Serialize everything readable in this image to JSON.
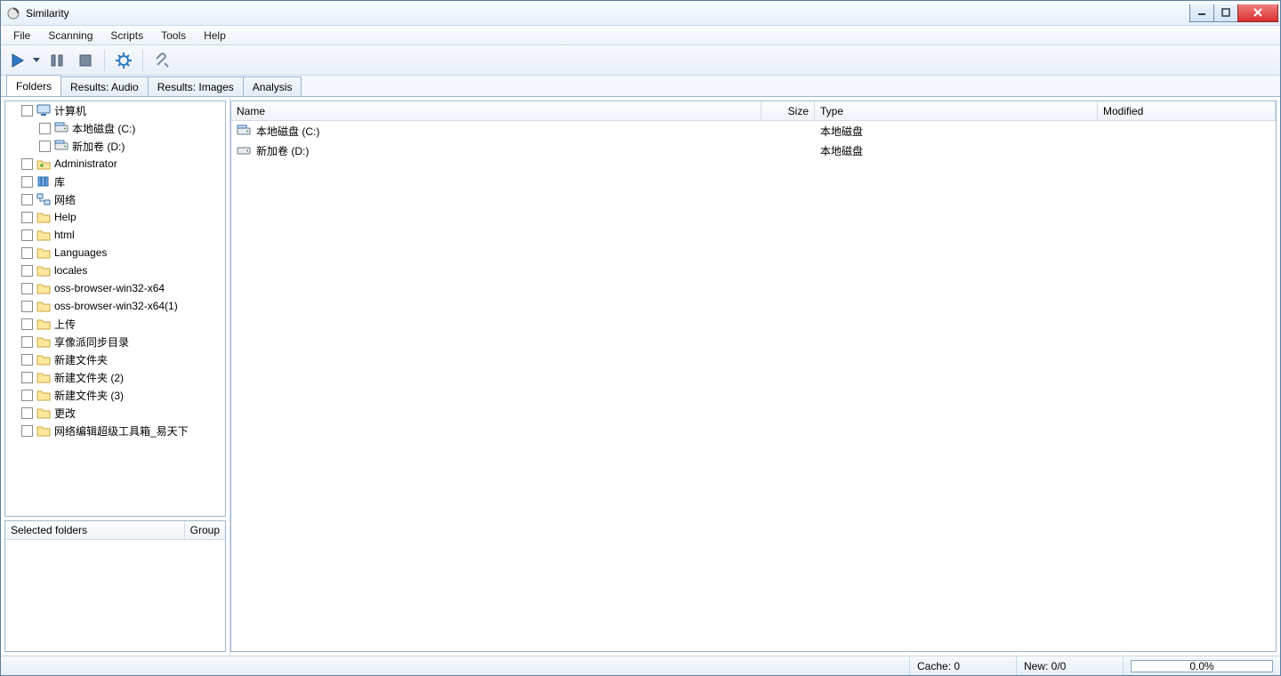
{
  "window": {
    "title": "Similarity"
  },
  "menu": {
    "items": [
      "File",
      "Scanning",
      "Scripts",
      "Tools",
      "Help"
    ]
  },
  "toolbar": {
    "play": "play",
    "dropdown": "▾",
    "pause": "pause",
    "stop": "stop",
    "settings": "settings",
    "tools": "tools"
  },
  "tabs": {
    "items": [
      "Folders",
      "Results: Audio",
      "Results: Images",
      "Analysis"
    ],
    "active": 0
  },
  "tree": {
    "root": {
      "label": "计算机",
      "icon": "computer"
    },
    "root_children": [
      {
        "label": "本地磁盘 (C:)",
        "icon": "drive"
      },
      {
        "label": "新加卷 (D:)",
        "icon": "drive"
      }
    ],
    "items": [
      {
        "label": "Administrator",
        "icon": "user-folder"
      },
      {
        "label": "库",
        "icon": "library"
      },
      {
        "label": "网络",
        "icon": "network"
      },
      {
        "label": "Help",
        "icon": "folder"
      },
      {
        "label": "html",
        "icon": "folder"
      },
      {
        "label": "Languages",
        "icon": "folder"
      },
      {
        "label": "locales",
        "icon": "folder"
      },
      {
        "label": "oss-browser-win32-x64",
        "icon": "folder"
      },
      {
        "label": "oss-browser-win32-x64(1)",
        "icon": "folder"
      },
      {
        "label": "上传",
        "icon": "folder"
      },
      {
        "label": "享像派同步目录",
        "icon": "folder"
      },
      {
        "label": "新建文件夹",
        "icon": "folder"
      },
      {
        "label": "新建文件夹 (2)",
        "icon": "folder"
      },
      {
        "label": "新建文件夹 (3)",
        "icon": "folder"
      },
      {
        "label": "更改",
        "icon": "folder"
      },
      {
        "label": "网络编辑超级工具箱_易天下",
        "icon": "folder"
      }
    ]
  },
  "selected_panel": {
    "col_folders": "Selected folders",
    "col_group": "Group"
  },
  "filelist": {
    "columns": {
      "name": "Name",
      "size": "Size",
      "type": "Type",
      "modified": "Modified"
    },
    "rows": [
      {
        "name": "本地磁盘 (C:)",
        "icon": "drive",
        "size": "",
        "type": "本地磁盘",
        "modified": ""
      },
      {
        "name": "新加卷 (D:)",
        "icon": "drive-plain",
        "size": "",
        "type": "本地磁盘",
        "modified": ""
      }
    ]
  },
  "status": {
    "cache": "Cache: 0",
    "new": "New: 0/0",
    "progress_text": "0.0%",
    "progress_value": 0
  }
}
